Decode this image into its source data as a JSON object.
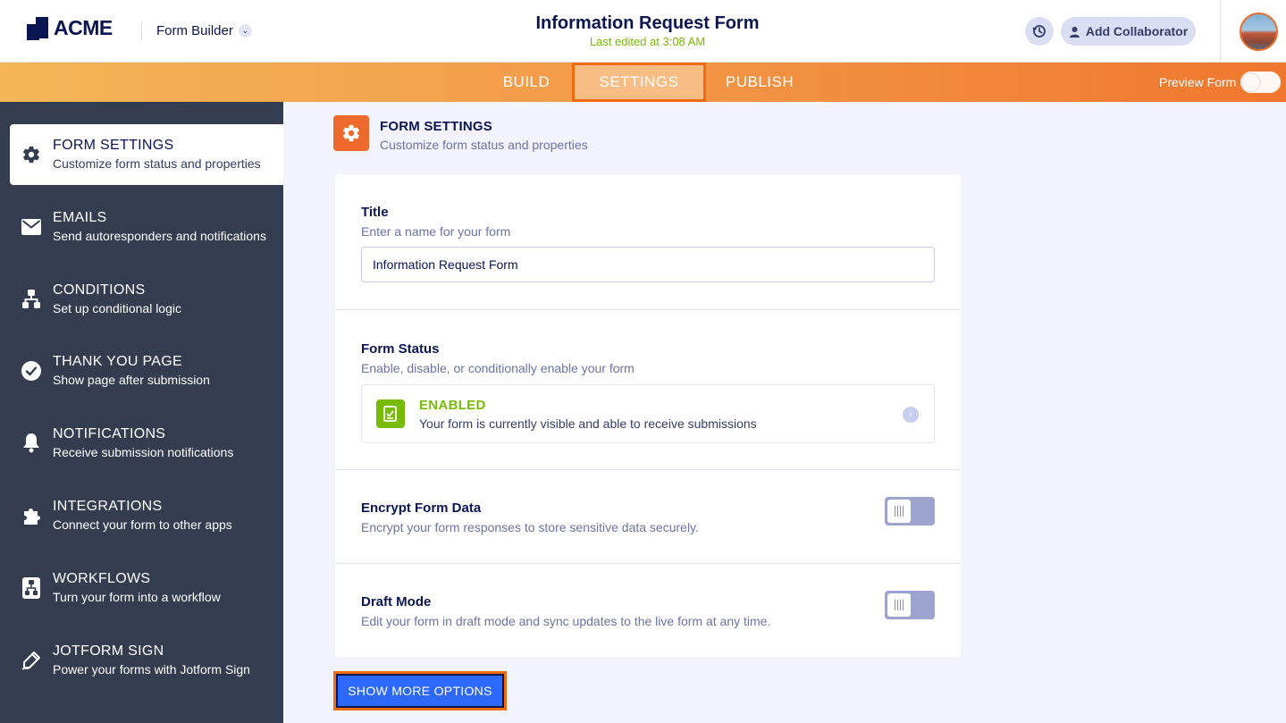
{
  "header": {
    "logo_text": "ACME",
    "app_switcher_label": "Form Builder",
    "form_title": "Information Request Form",
    "last_edited": "Last edited at 3:08 AM",
    "add_collaborator_label": "Add Collaborator"
  },
  "nav": {
    "tabs": [
      {
        "label": "BUILD",
        "active": false
      },
      {
        "label": "SETTINGS",
        "active": true
      },
      {
        "label": "PUBLISH",
        "active": false
      }
    ],
    "preview_label": "Preview Form",
    "preview_on": false
  },
  "sidebar": {
    "items": [
      {
        "title": "FORM SETTINGS",
        "desc": "Customize form status and properties",
        "icon": "gear-icon",
        "active": true
      },
      {
        "title": "EMAILS",
        "desc": "Send autoresponders and notifications",
        "icon": "envelope-icon",
        "active": false
      },
      {
        "title": "CONDITIONS",
        "desc": "Set up conditional logic",
        "icon": "flowchart-icon",
        "active": false
      },
      {
        "title": "THANK YOU PAGE",
        "desc": "Show page after submission",
        "icon": "check-circle-icon",
        "active": false
      },
      {
        "title": "NOTIFICATIONS",
        "desc": "Receive submission notifications",
        "icon": "bell-icon",
        "active": false
      },
      {
        "title": "INTEGRATIONS",
        "desc": "Connect your form to other apps",
        "icon": "puzzle-icon",
        "active": false
      },
      {
        "title": "WORKFLOWS",
        "desc": "Turn your form into a workflow",
        "icon": "workflow-icon",
        "active": false
      },
      {
        "title": "JOTFORM SIGN",
        "desc": "Power your forms with Jotform Sign",
        "icon": "pen-icon",
        "active": false
      }
    ]
  },
  "main": {
    "section_title": "FORM SETTINGS",
    "section_sub": "Customize form status and properties",
    "title_field": {
      "label": "Title",
      "desc": "Enter a name for your form",
      "value": "Information Request Form"
    },
    "status": {
      "label": "Form Status",
      "desc": "Enable, disable, or conditionally enable your form",
      "value": "ENABLED",
      "value_desc": "Your form is currently visible and able to receive submissions"
    },
    "encrypt": {
      "label": "Encrypt Form Data",
      "desc": "Encrypt your form responses to store sensitive data securely.",
      "on": false
    },
    "draft": {
      "label": "Draft Mode",
      "desc": "Edit your form in draft mode and sync updates to the live form at any time.",
      "on": false
    },
    "show_more_label": "SHOW MORE OPTIONS"
  },
  "colors": {
    "accent_orange": "#ED6A2C",
    "highlight_border": "#F06A0F",
    "enabled_green": "#78BB07",
    "navy": "#0A1551",
    "sidebar_bg": "#343C4F",
    "button_blue": "#2E69FF"
  }
}
